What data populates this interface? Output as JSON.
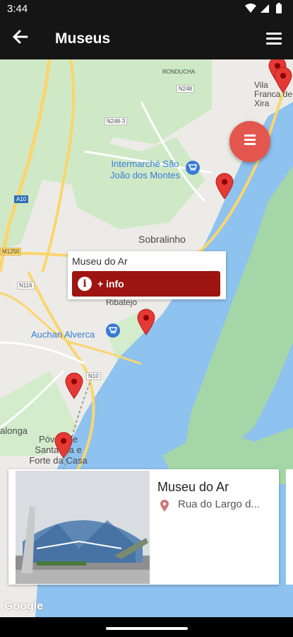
{
  "status_bar": {
    "time": "3:44",
    "icons": "▾◢▮"
  },
  "app_bar": {
    "title": "Museus",
    "back_icon": "arrow-left-icon",
    "menu_icon": "hamburger-menu-icon"
  },
  "map": {
    "labels": {
      "ronducha": "RONDUCHA",
      "vila_franca": "Vila Franca de Xira",
      "n248": "N248",
      "n248_3": "N248-3",
      "intermarche": "Intermarché São João dos Montes",
      "a10": "A10",
      "sobralinho": "Sobralinho",
      "m1250": "M1250",
      "n116": "N116",
      "ribatejo": "Ribatejo",
      "auchan": "Auchan Alverca",
      "n10": "N10",
      "alonga": "alonga",
      "povoa": "Póvoa de Santa Iria e Forte da Casa"
    },
    "fab_icon": "list-icon",
    "marker_icon": "map-marker-icon"
  },
  "popup": {
    "title": "Museu do Ar",
    "button_label": "+ info",
    "button_icon": "info-icon"
  },
  "card": {
    "title": "Museu do Ar",
    "address": "Rua do Largo d...",
    "pin_icon": "location-pin-icon"
  },
  "google_logo": "Google",
  "colors": {
    "primary": "#9e1410",
    "fab": "#e4574e",
    "water": "#8ec2ef",
    "park": "#c8e6c9",
    "road": "#fbd56f"
  }
}
